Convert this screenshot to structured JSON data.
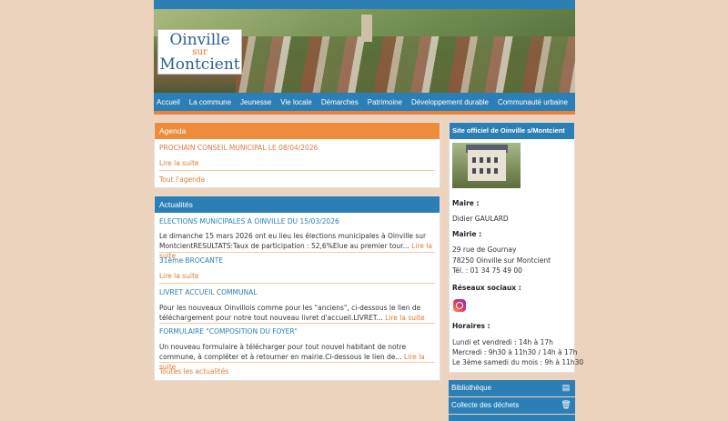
{
  "logo": {
    "line1": "Oinville",
    "line2": "sur",
    "line3": "Montcient"
  },
  "nav": [
    "Accueil",
    "La commune",
    "Jeunesse",
    "Vie locale",
    "Démarches",
    "Patrimoine",
    "Développement durable",
    "Communauté urbaine"
  ],
  "agenda": {
    "title": "Agenda",
    "event": "PROCHAIN CONSEIL MUNICIPAL LE 08/04/2026",
    "read_more": "Lire la suite",
    "all": "Tout l'agenda"
  },
  "news": {
    "title": "Actualités",
    "items": [
      {
        "title": "ELECTIONS MUNICIPALES A OINVILLE DU 15/03/2026",
        "text": "Le dimanche 15 mars 2026 ont eu lieu les élections municipales à Oinville sur MontcientRESULTATS:Taux de participation : 52,6%Elue au premier tour...",
        "more": "Lire la suite"
      },
      {
        "title": "31ème BROCANTE",
        "text": "",
        "more": "Lire la suite"
      },
      {
        "title": "LIVRET ACCUEIL COMMUNAL",
        "text": "Pour les nouveaux Oinvillois comme pour les \"anciens\", ci-dessous le lien de téléchargement pour notre tout nouveau livret d'accueil.LIVRET...",
        "more": "Lire la suite"
      },
      {
        "title": "FORMULAIRE \"COMPOSITION DU FOYER\"",
        "text": "Un nouveau formulaire à télécharger pour tout nouvel habitant de notre commune, à compléter et à retourner en mairie.Ci-dessous le lien de...",
        "more": "Lire la suite"
      }
    ],
    "all": "Toutes les actualités"
  },
  "sidebar": {
    "title": "Site officiel de Oinville s/Montcient",
    "maire_label": "Maire :",
    "maire_name": "Didier GAULARD",
    "mairie_label": "Mairie :",
    "address1": "29 rue de Gournay",
    "address2": "78250 Oinville sur Montcient",
    "phone": "Tél. : 01 34 75 49 00",
    "social_label": "Réseaux sociaux :",
    "hours_label": "Horaires :",
    "hours1": "Lundi et vendredi : 14h à 17h",
    "hours2": "Mercredi : 9h30 à 11h30 / 14h à 17h",
    "hours3": "Le 3ème samedi du mois : 9h à 11h30"
  },
  "side_buttons": [
    {
      "label": "Bibliothèque",
      "icon": "books-icon"
    },
    {
      "label": "Collecte des déchets",
      "icon": "trash-icon"
    }
  ],
  "colors": {
    "blue": "#2b7fb5",
    "orange": "#ef8c3a",
    "background": "#ecd3bd"
  }
}
